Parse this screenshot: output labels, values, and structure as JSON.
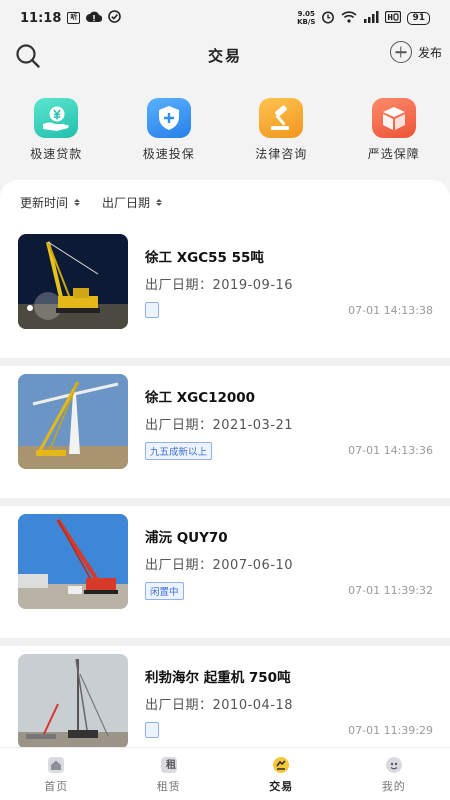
{
  "status_bar": {
    "time": "11:18",
    "speed_value": "9.05",
    "speed_unit": "KB/S",
    "battery": "91"
  },
  "header": {
    "title": "交易",
    "publish_label": "发布"
  },
  "services": [
    {
      "label": "极速贷款",
      "icon": "yen-hand-icon",
      "color": "#2ecbb7"
    },
    {
      "label": "极速投保",
      "icon": "shield-plus-icon",
      "color": "#2f8ff0"
    },
    {
      "label": "法律咨询",
      "icon": "gavel-icon",
      "color": "#f3a52b"
    },
    {
      "label": "严选保障",
      "icon": "box-icon",
      "color": "#f2644e"
    }
  ],
  "filters": [
    {
      "label": "更新时间"
    },
    {
      "label": "出厂日期"
    }
  ],
  "listings": [
    {
      "name": "徐工 XGC55 55吨",
      "date_label": "出厂日期：",
      "date": "2019-09-16",
      "tag": "",
      "time": "07-01 14:13:38"
    },
    {
      "name": "徐工 XGC12000",
      "date_label": "出厂日期：",
      "date": "2021-03-21",
      "tag": "九五成新以上",
      "time": "07-01 14:13:36"
    },
    {
      "name": "浦沅 QUY70",
      "date_label": "出厂日期：",
      "date": "2007-06-10",
      "tag": "闲置中",
      "time": "07-01 11:39:32"
    },
    {
      "name": "利勃海尔 起重机 750吨",
      "date_label": "出厂日期：",
      "date": "2010-04-18",
      "tag": "",
      "time": "07-01 11:39:29"
    }
  ],
  "tabbar": [
    {
      "label": "首页",
      "icon": "home-icon",
      "active": false
    },
    {
      "label": "租赁",
      "icon": "rent-icon",
      "active": false
    },
    {
      "label": "交易",
      "icon": "trade-icon",
      "active": true
    },
    {
      "label": "我的",
      "icon": "profile-icon",
      "active": false
    }
  ],
  "tab_rent_glyph": "租"
}
